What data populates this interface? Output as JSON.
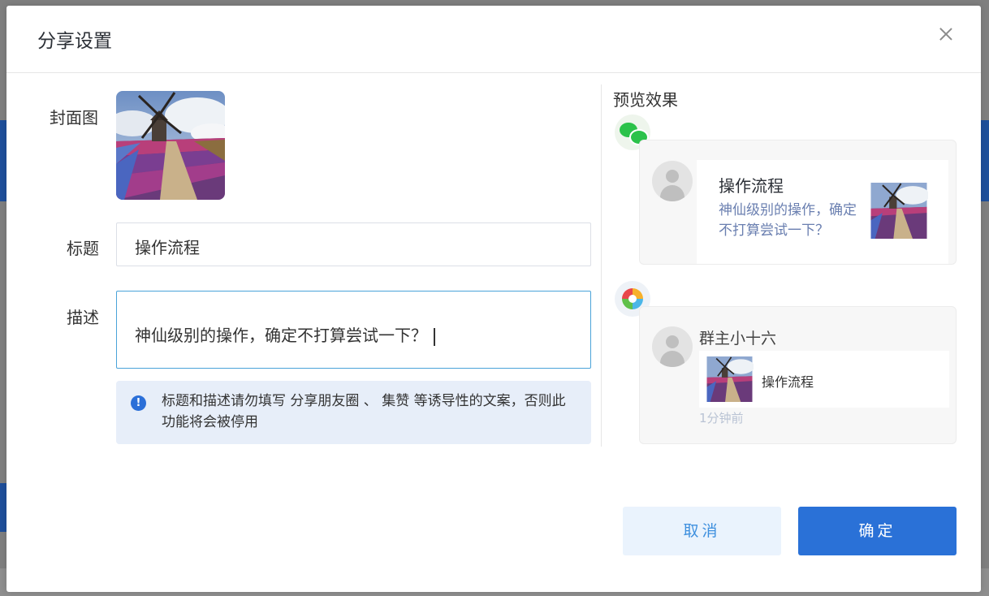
{
  "dialog": {
    "title": "分享设置"
  },
  "form": {
    "cover_label": "封面图",
    "title_label": "标题",
    "title_value": "操作流程",
    "desc_label": "描述",
    "desc_value": "神仙级别的操作，确定不打算尝试一下？",
    "notice": "标题和描述请勿填写 分享朋友圈 、 集赞 等诱导性的文案，否则此功能将会被停用"
  },
  "preview": {
    "title": "预览效果",
    "wechat": {
      "icon": "wechat-icon",
      "title": "操作流程",
      "desc": "神仙级别的操作，确定不打算尝试一下？"
    },
    "moments": {
      "icon": "moments-icon",
      "poster_name": "群主小十六",
      "share_title": "操作流程",
      "time": "1分钟前"
    }
  },
  "footer": {
    "cancel_label": "取消",
    "confirm_label": "确定"
  },
  "colors": {
    "primary": "#2a71d7",
    "cancel_bg": "#eaf3fd",
    "notice_bg": "#e7eef9",
    "wechat_green": "#2bc24a"
  }
}
